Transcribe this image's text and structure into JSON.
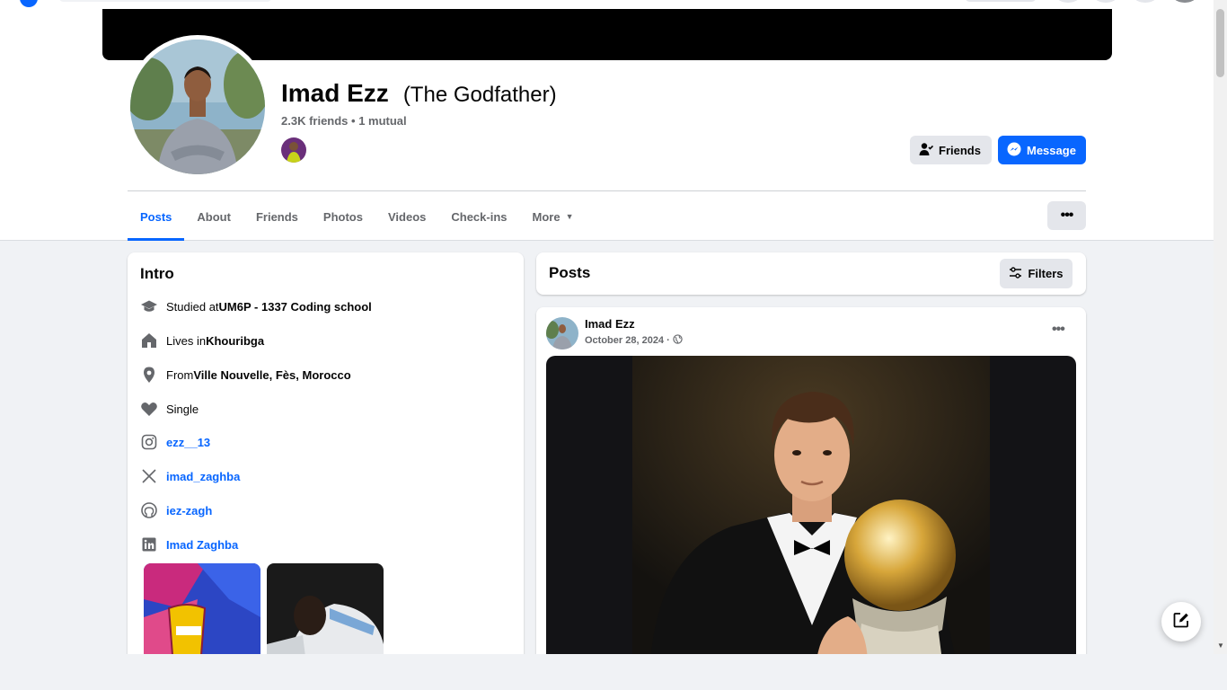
{
  "profile": {
    "name": "Imad Ezz",
    "nickname": "(The Godfather)",
    "friends_line": "2.3K friends • 1 mutual"
  },
  "actions": {
    "friends_label": "Friends",
    "message_label": "Message",
    "more_options": "•••"
  },
  "tabs": [
    {
      "label": "Posts",
      "active": true
    },
    {
      "label": "About"
    },
    {
      "label": "Friends"
    },
    {
      "label": "Photos"
    },
    {
      "label": "Videos"
    },
    {
      "label": "Check-ins"
    },
    {
      "label": "More"
    }
  ],
  "intro": {
    "title": "Intro",
    "items": [
      {
        "icon": "graduation-cap-icon",
        "prefix": "Studied at ",
        "value": "UM6P - 1337 Coding school"
      },
      {
        "icon": "home-icon",
        "prefix": "Lives in ",
        "value": "Khouribga"
      },
      {
        "icon": "location-pin-icon",
        "prefix": "From ",
        "value": "Ville Nouvelle, Fès, Morocco"
      },
      {
        "icon": "heart-icon",
        "prefix": "Single",
        "value": ""
      },
      {
        "icon": "instagram-icon",
        "prefix": "",
        "value": "ezz__13"
      },
      {
        "icon": "x-icon",
        "prefix": "",
        "value": "imad_zaghba"
      },
      {
        "icon": "github-icon",
        "prefix": "",
        "value": "iez-zagh"
      },
      {
        "icon": "linkedin-icon",
        "prefix": "",
        "value": "Imad Zaghba"
      }
    ]
  },
  "posts": {
    "title": "Posts",
    "filters_label": "Filters",
    "items": [
      {
        "author": "Imad Ezz",
        "date": "October 28, 2024 ·",
        "menu": "•••"
      }
    ]
  },
  "colors": {
    "accent": "#0866ff",
    "muted": "#65676b",
    "button_gray": "#e4e6eb",
    "page_bg": "#f0f2f5"
  }
}
